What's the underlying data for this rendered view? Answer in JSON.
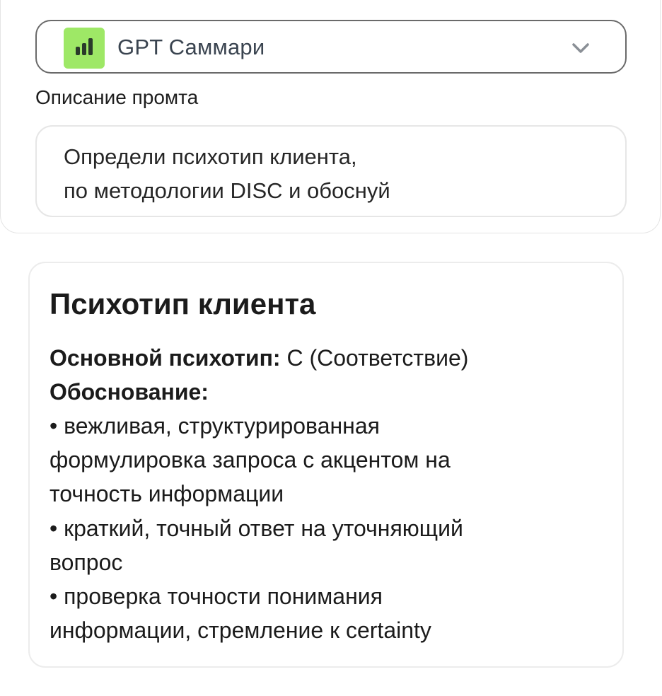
{
  "model_selector": {
    "icon": "bar-chart-icon",
    "icon_bg": "#9ee866",
    "label": "GPT Саммари",
    "chevron": "chevron-down-icon"
  },
  "prompt": {
    "heading": "Описание промта",
    "lines": [
      "Определи психотип клиента,",
      "по методологии DISC и обоснуй"
    ]
  },
  "result": {
    "title": "Психотип клиента",
    "main_type_label": "Основной психотип:",
    "main_type_value": " С (Соответствие)",
    "rationale_label": "Обоснование:",
    "lines": [
      "• вежливая, структурированная",
      "формулировка запроса с акцентом на",
      "точность информации",
      "• краткий, точный ответ на уточняющий",
      "вопрос",
      "• проверка точности понимания",
      "информации, стремление к certainty"
    ]
  }
}
